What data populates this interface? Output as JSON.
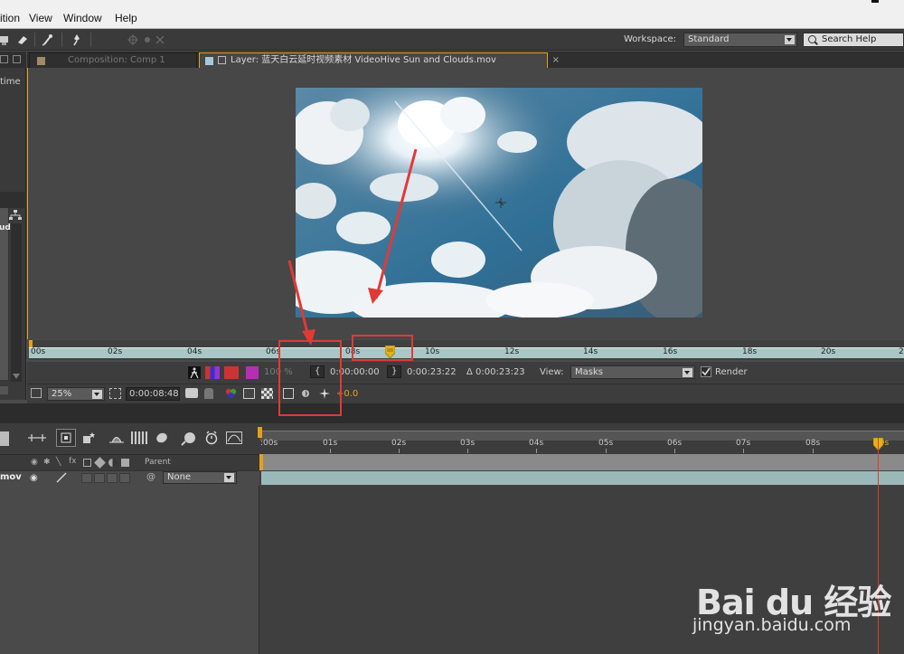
{
  "menu": {
    "items": [
      "ition",
      "View",
      "Window",
      "Help"
    ]
  },
  "toolbar": {
    "workspace_label": "Workspace:",
    "workspace_value": "Standard",
    "search_placeholder": "Search Help"
  },
  "left_panel": {
    "partial_label_1": "time",
    "partial_label_2": "ud"
  },
  "viewer": {
    "tab_comp_label": "Composition: Comp 1",
    "tab_layer_label": "Layer: 蓝天白云延时视频素材 VideoHive Sun and Clouds.mov",
    "ruler_ticks": [
      "00s",
      "02s",
      "04s",
      "06s",
      "08s",
      "10s",
      "12s",
      "14s",
      "16s",
      "18s",
      "20s",
      "2"
    ],
    "in_point": "0:00:00:00",
    "out_point": "0:00:23:22",
    "duration": "Δ 0:00:23:23",
    "view_label": "View:",
    "view_value": "Masks",
    "render_label": "Render",
    "render_checked": true,
    "zoom_value": "25%",
    "current_time": "0:00:08:48",
    "opacity_value": "100 %",
    "exposure_value": "+0.0"
  },
  "timeline": {
    "ruler_ticks": [
      ":00s",
      "01s",
      "02s",
      "03s",
      "04s",
      "05s",
      "06s",
      "07s",
      "08s",
      "09s"
    ],
    "parent_header": "Parent",
    "layer_name_partial": "mov",
    "parent_value": "None",
    "playhead_label": "09s"
  },
  "colors": {
    "accent_orange": "#e3a21a",
    "annotation_red": "#e03a37",
    "playhead_red": "#e23a2a",
    "layer_bar": "#9ab9b8"
  },
  "watermark": {
    "logo_text": "Bai du 经验",
    "url": "jingyan.baidu.com"
  }
}
